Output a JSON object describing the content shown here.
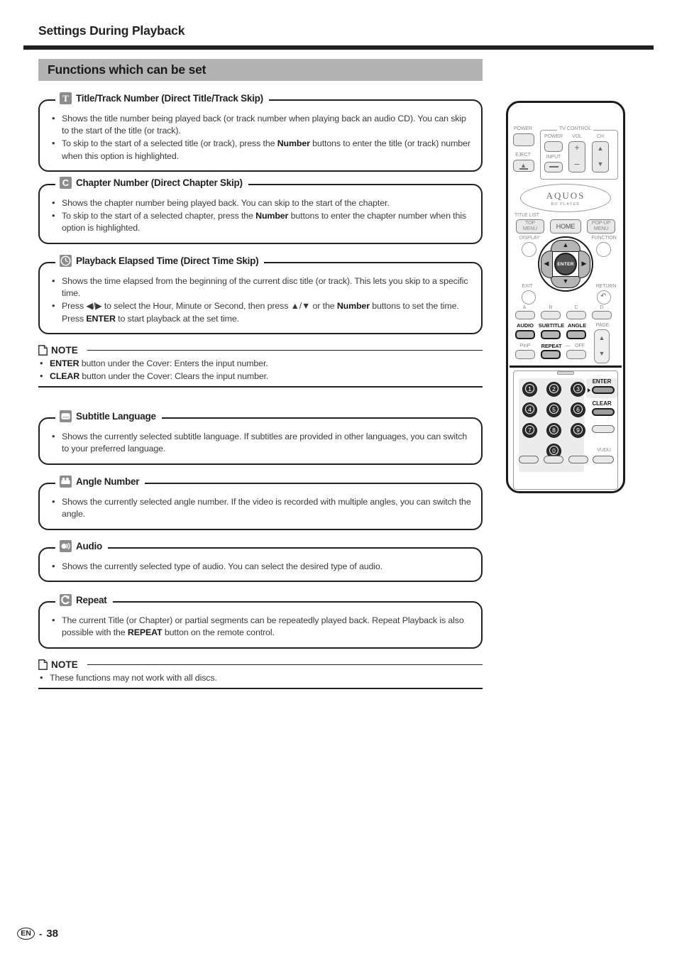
{
  "header": {
    "title": "Settings During Playback",
    "section_banner": "Functions which can be set"
  },
  "sections": [
    {
      "id": "title-track-number",
      "icon": "title-badge-icon",
      "icon_glyph": "T",
      "legend": "Title/Track Number (Direct Title/Track Skip)",
      "bullets": [
        "Shows the title number being played back (or track number when playing back an audio CD). You can skip to the start of the title (or track).",
        "To skip to the start of a selected title (or track), press the <b>Number</b> buttons to enter the title (or track) number when this option is highlighted."
      ]
    },
    {
      "id": "chapter-number",
      "icon": "chapter-badge-icon",
      "icon_glyph": "C",
      "legend": "Chapter Number (Direct Chapter Skip)",
      "bullets": [
        "Shows the chapter number being played back. You can skip to the start of the chapter.",
        "To skip to the start of a selected chapter, press the <b>Number</b> buttons to enter the chapter number when this option is highlighted."
      ]
    },
    {
      "id": "playback-elapsed-time",
      "icon": "clock-badge-icon",
      "icon_glyph": "clock",
      "legend": "Playback Elapsed Time (Direct Time Skip)",
      "bullets": [
        "Shows the time elapsed from the beginning of the current disc title (or track). This lets you skip to a specific time.",
        "Press ◀/▶ to select the Hour, Minute or Second, then press ▲/▼ or the <b>Number</b> buttons to set the time. Press <b>ENTER</b> to start playback at the set time."
      ]
    },
    {
      "id": "subtitle-language",
      "icon": "subtitle-badge-icon",
      "icon_glyph": "subtitle",
      "legend": "Subtitle Language",
      "bullets": [
        "Shows the currently selected subtitle language. If subtitles are provided in other languages, you can switch to your preferred language."
      ]
    },
    {
      "id": "angle-number",
      "icon": "angle-badge-icon",
      "icon_glyph": "camera",
      "legend": "Angle Number",
      "bullets": [
        "Shows the currently selected angle number. If the video is recorded with multiple angles, you can switch the angle."
      ]
    },
    {
      "id": "audio",
      "icon": "audio-badge-icon",
      "icon_glyph": "speaker",
      "legend": "Audio",
      "bullets": [
        "Shows the currently selected type of audio. You can select the desired type of audio."
      ]
    },
    {
      "id": "repeat",
      "icon": "repeat-badge-icon",
      "icon_glyph": "repeat",
      "legend": "Repeat",
      "bullets": [
        "The current Title (or Chapter) or partial segments can be repeatedly played back. Repeat Playback is also possible with the <b>REPEAT</b> button on the remote control."
      ]
    }
  ],
  "notes": [
    {
      "id": "note-enter-clear",
      "title": "NOTE",
      "bullets": [
        "<b>ENTER</b> button under the Cover: Enters the input number.",
        "<b>CLEAR</b> button under the Cover: Clears the input number."
      ]
    },
    {
      "id": "note-discs",
      "title": "NOTE",
      "bullets": [
        "These functions may not work with all discs."
      ]
    }
  ],
  "remote": {
    "power_label": "POWER",
    "eject_label": "EJECT",
    "tv_control_caption": "TV CONTROL",
    "tv_power_label": "POWER",
    "tv_vol_label": "VOL",
    "tv_ch_label": "CH",
    "tv_input_label": "INPUT",
    "vol_plus": "+",
    "vol_minus": "–",
    "brand_name": "AQUOS",
    "brand_sub": "BD PLAYER",
    "title_list_label": "TITLE LIST",
    "top_menu_label_1": "TOP",
    "top_menu_label_2": "MENU",
    "home_label": "HOME",
    "popup_menu_label_1": "POP-UP",
    "popup_menu_label_2": "MENU",
    "display_label": "DISPLAY",
    "function_label": "FUNCTION",
    "exit_label": "EXIT",
    "return_label": "RETURN",
    "enter_label": "ENTER",
    "color_buttons": [
      "A",
      "B",
      "C",
      "D"
    ],
    "audio_label": "AUDIO",
    "subtitle_label": "SUBTITLE",
    "angle_label": "ANGLE",
    "page_label": "PAGE",
    "pinp_label": "PinP",
    "repeat_label": "REPEAT",
    "repeat_dash": "—",
    "off_label": "OFF",
    "keypad": [
      "1",
      "2",
      "3",
      "4",
      "5",
      "6",
      "7",
      "8",
      "9",
      "0"
    ],
    "keypad_enter_label": "ENTER",
    "keypad_clear_label": "CLEAR",
    "vudu_label": "VUDU"
  },
  "footer": {
    "language_code": "EN",
    "separator": "-",
    "page_number": "38"
  }
}
